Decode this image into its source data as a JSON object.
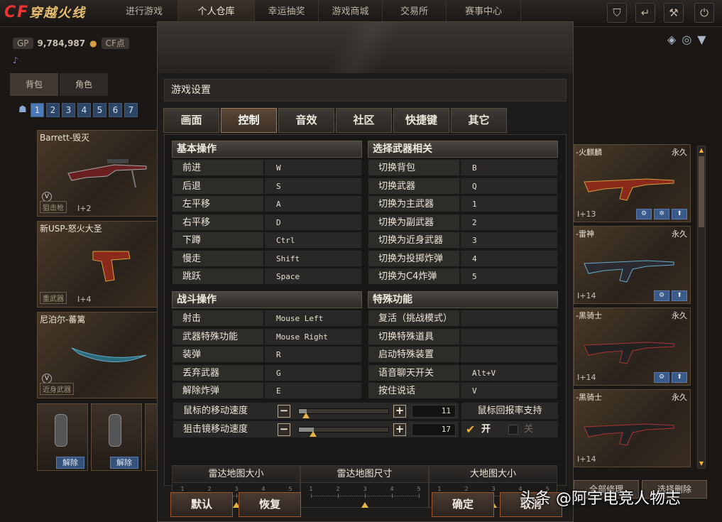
{
  "app": {
    "logo_text": "穿越火线",
    "logo_mark": "CF"
  },
  "topnav": {
    "tabs": [
      {
        "label": "进行游戏"
      },
      {
        "label": "个人仓库",
        "active": true
      },
      {
        "label": "幸运抽奖"
      },
      {
        "label": "游戏商城"
      },
      {
        "label": "交易所"
      },
      {
        "label": "赛事中心"
      }
    ],
    "icons": [
      "shield-icon",
      "logout-arrow-icon",
      "wrench-icon",
      "power-icon"
    ]
  },
  "currency": {
    "gp_tag": "GP",
    "gp_value": "9,784,987",
    "cf_tag": "CF点"
  },
  "inventory": {
    "subtabs": [
      "背包",
      "角色"
    ],
    "pages": [
      "1",
      "2",
      "3",
      "4",
      "5",
      "6",
      "7"
    ],
    "left_cards": [
      {
        "name": "Barrett-毁灭",
        "badge": "狙击枪",
        "level": "I+2"
      },
      {
        "name": "新USP-怒火大圣",
        "badge": "重武器",
        "level": "I+4"
      },
      {
        "name": "尼泊尔-蕃篱",
        "badge": "近身武器",
        "level": ""
      }
    ],
    "small_cards": [
      {
        "unlock": "解除"
      },
      {
        "unlock": "解除"
      }
    ],
    "right_cards": [
      {
        "name": "-火麒麟",
        "perm": "永久",
        "level": "I+13"
      },
      {
        "name": "-雷神",
        "perm": "永久",
        "level": "I+14"
      },
      {
        "name": "-黑骑士",
        "perm": "永久",
        "level": "I+14"
      },
      {
        "name": "-黑骑士",
        "perm": "永久",
        "level": "I+14"
      }
    ],
    "bottom_buttons": [
      "全部修理",
      "选择删除"
    ]
  },
  "modal": {
    "title": "游戏设置",
    "tabs": [
      "画面",
      "控制",
      "音效",
      "社区",
      "快捷键",
      "其它"
    ],
    "active_tab": "控制",
    "basic": {
      "header": "基本操作",
      "rows": [
        {
          "k": "前进",
          "v": "W"
        },
        {
          "k": "后退",
          "v": "S"
        },
        {
          "k": "左平移",
          "v": "A"
        },
        {
          "k": "右平移",
          "v": "D"
        },
        {
          "k": "下蹲",
          "v": "Ctrl"
        },
        {
          "k": "慢走",
          "v": "Shift"
        },
        {
          "k": "跳跃",
          "v": "Space"
        }
      ]
    },
    "weapon": {
      "header": "选择武器相关",
      "rows": [
        {
          "k": "切换背包",
          "v": "B"
        },
        {
          "k": "切换武器",
          "v": "Q"
        },
        {
          "k": "切换为主武器",
          "v": "1"
        },
        {
          "k": "切换为副武器",
          "v": "2"
        },
        {
          "k": "切换为近身武器",
          "v": "3"
        },
        {
          "k": "切换为投掷炸弹",
          "v": "4"
        },
        {
          "k": "切换为C4炸弹",
          "v": "5"
        }
      ]
    },
    "combat": {
      "header": "战斗操作",
      "rows": [
        {
          "k": "射击",
          "v": "Mouse Left"
        },
        {
          "k": "武器特殊功能",
          "v": "Mouse Right"
        },
        {
          "k": "装弹",
          "v": "R"
        },
        {
          "k": "丢弃武器",
          "v": "G"
        },
        {
          "k": "解除炸弹",
          "v": "E"
        }
      ]
    },
    "special": {
      "header": "特殊功能",
      "rows": [
        {
          "k": "复活（挑战模式）",
          "v": ""
        },
        {
          "k": "切换特殊道具",
          "v": ""
        },
        {
          "k": "启动特殊装置",
          "v": ""
        },
        {
          "k": "语音聊天开关",
          "v": "Alt+V"
        },
        {
          "k": "按住说话",
          "v": "V"
        }
      ]
    },
    "sliders": [
      {
        "label": "鼠标的移动速度",
        "value": "11",
        "fraction": 0.09
      },
      {
        "label": "狙击镜移动速度",
        "value": "17",
        "fraction": 0.17
      }
    ],
    "refresh": {
      "title": "鼠标回报率支持",
      "on_label": "开",
      "off_label": "关",
      "selected": "on"
    },
    "maps": [
      {
        "label": "雷达地图大小",
        "ticks": [
          "1",
          "2",
          "3",
          "4",
          "5"
        ],
        "value": 3
      },
      {
        "label": "雷达地图尺寸",
        "ticks": [
          "1",
          "2",
          "3",
          "4",
          "5"
        ],
        "value": 3
      },
      {
        "label": "大地图大小",
        "ticks": [
          "1",
          "2",
          "3",
          "4",
          "5"
        ],
        "value": 3
      }
    ],
    "buttons": {
      "default": "默认",
      "restore": "恢复",
      "ok": "确定",
      "cancel": "取消"
    }
  },
  "watermark": "头条 @阿宇电竞人物志"
}
